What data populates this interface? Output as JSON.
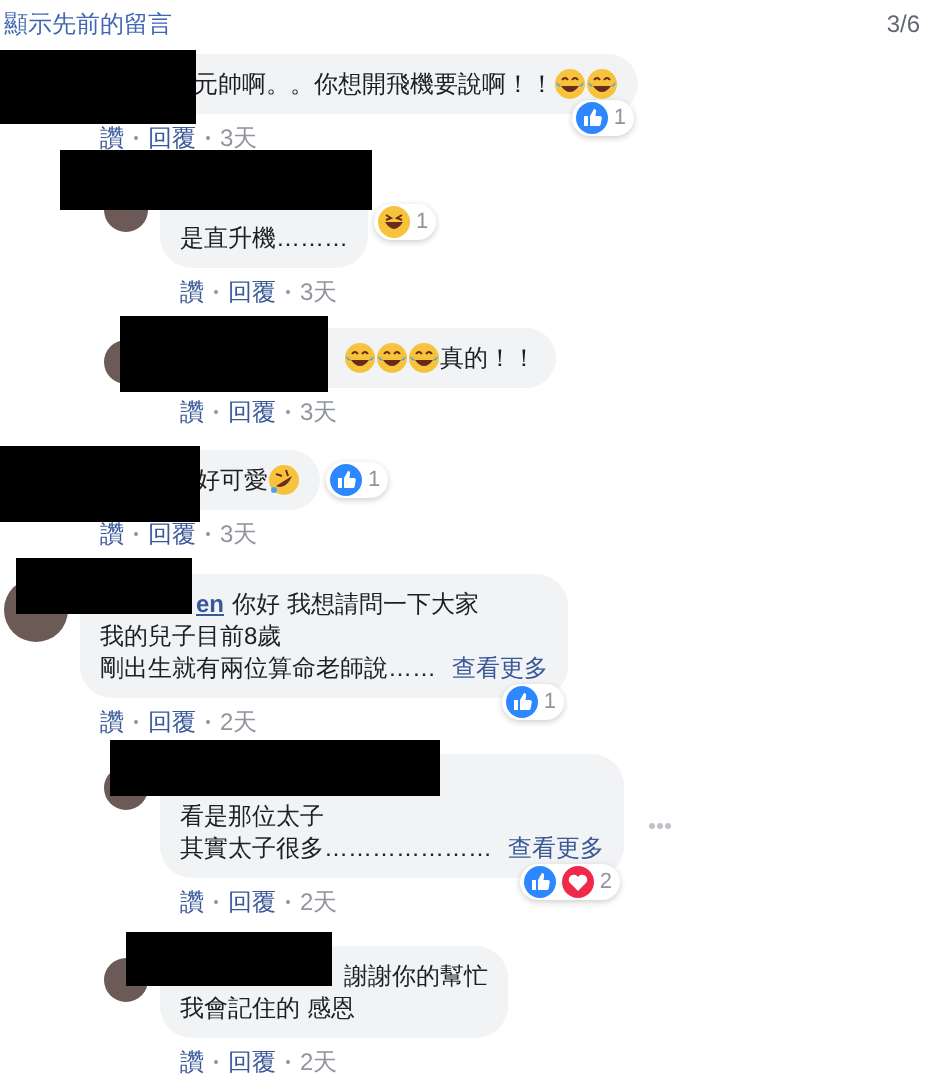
{
  "header": {
    "link": "顯示先前的留言",
    "pager": "3/6"
  },
  "comments": [
    {
      "redacted": true,
      "lines": [
        [
          {
            "kind": "text",
            "text": "元帥啊。。你想開飛機要說啊！！"
          },
          {
            "kind": "tears_emoji"
          },
          {
            "kind": "tears_emoji"
          }
        ]
      ],
      "reactions": {
        "icons": [
          {
            "kind": "like"
          }
        ],
        "count": "1"
      },
      "actions": {
        "like": "讚",
        "reply": "回覆",
        "time": "3天"
      },
      "children": [
        {
          "redacted": true,
          "avatar": true,
          "hidden_name_line": true,
          "lines": [
            [
              {
                "kind": "text",
                "text": "是直升機………"
              }
            ]
          ],
          "reactions": {
            "icons": [
              {
                "kind": "haha"
              }
            ],
            "count": "1"
          },
          "actions": {
            "like": "讚",
            "reply": "回覆",
            "time": "3天"
          }
        },
        {
          "redacted": true,
          "avatar": true,
          "lines": [
            [
              {
                "kind": "tears_emoji"
              },
              {
                "kind": "tears_emoji"
              },
              {
                "kind": "tears_emoji"
              },
              {
                "kind": "text",
                "text": "真的！！"
              }
            ]
          ],
          "actions": {
            "like": "讚",
            "reply": "回覆",
            "time": "3天"
          }
        }
      ]
    },
    {
      "redacted": true,
      "lines": [
        [
          {
            "kind": "text",
            "text": "好可愛"
          },
          {
            "kind": "rofl_emoji"
          }
        ]
      ],
      "reactions": {
        "icons": [
          {
            "kind": "like"
          }
        ],
        "count": "1"
      },
      "actions": {
        "like": "讚",
        "reply": "回覆",
        "time": "3天"
      }
    },
    {
      "redacted": true,
      "avatar": true,
      "lines": [
        [
          {
            "kind": "name",
            "text": "en"
          },
          {
            "kind": "text",
            "text": "你好 我想請問一下大家"
          }
        ],
        [
          {
            "kind": "text",
            "text": "我的兒子目前8歲"
          }
        ],
        [
          {
            "kind": "text",
            "text": "剛出生就有兩位算命老師說……"
          },
          {
            "kind": "link",
            "text": "查看更多"
          }
        ]
      ],
      "reactions": {
        "icons": [
          {
            "kind": "like"
          }
        ],
        "count": "1"
      },
      "actions": {
        "like": "讚",
        "reply": "回覆",
        "time": "2天"
      },
      "children": [
        {
          "redacted": true,
          "avatar": true,
          "hidden_name_line": true,
          "more_menu": true,
          "lines": [
            [
              {
                "kind": "text",
                "text": "看是那位太子"
              }
            ],
            [
              {
                "kind": "text",
                "text": "其實太子很多…………………"
              },
              {
                "kind": "link",
                "text": "查看更多"
              }
            ]
          ],
          "reactions": {
            "icons": [
              {
                "kind": "like"
              },
              {
                "kind": "love"
              }
            ],
            "count": "2"
          },
          "actions": {
            "like": "讚",
            "reply": "回覆",
            "time": "2天"
          }
        },
        {
          "redacted": true,
          "avatar": true,
          "lines": [
            [
              {
                "kind": "text",
                "text": "謝謝你的幫忙"
              }
            ],
            [
              {
                "kind": "text",
                "text": "我會記住的 感恩"
              }
            ]
          ],
          "actions": {
            "like": "讚",
            "reply": "回覆",
            "time": "2天"
          }
        }
      ]
    }
  ]
}
